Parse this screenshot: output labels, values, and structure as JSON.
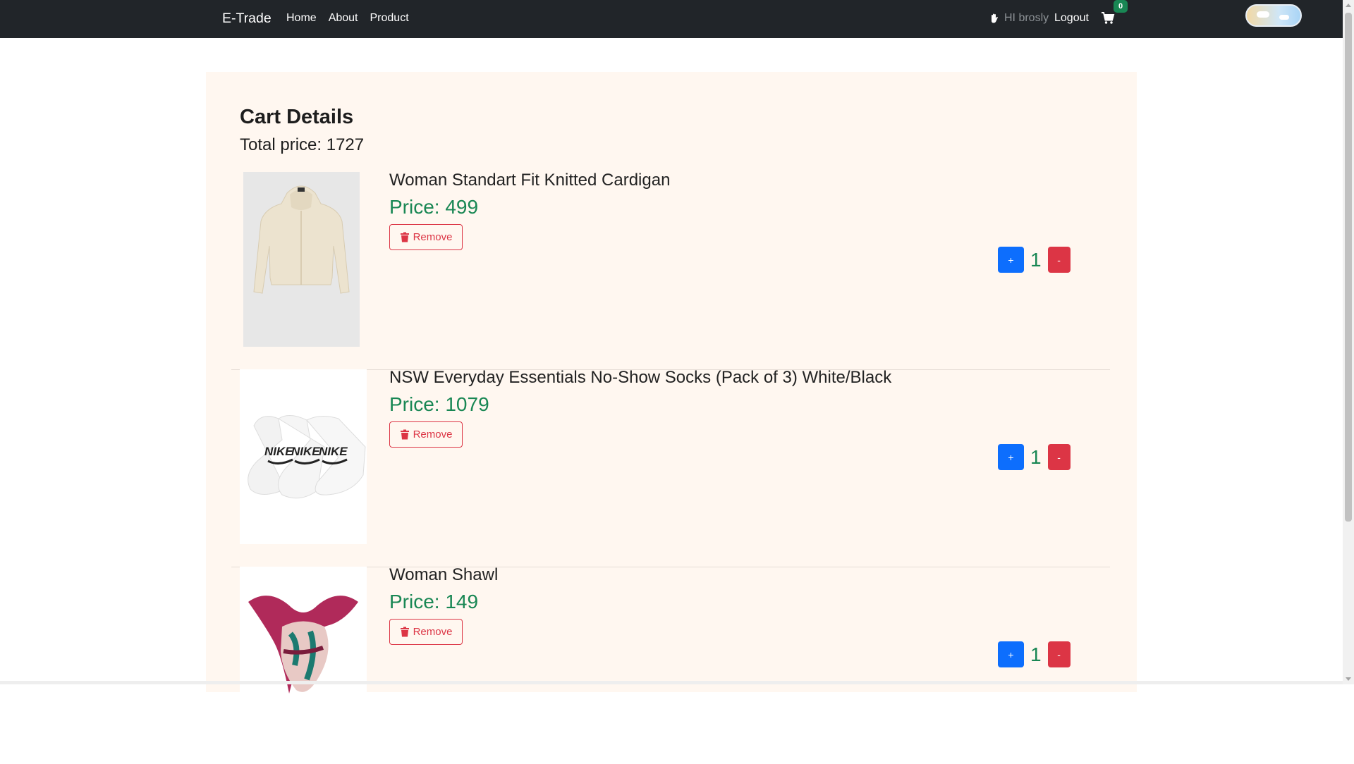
{
  "navbar": {
    "brand": "E-Trade",
    "links": [
      "Home",
      "About",
      "Product"
    ],
    "greeting": "HI brosly",
    "logout": "Logout",
    "cart_count": "0"
  },
  "cart": {
    "title": "Cart Details",
    "total_label": "Total price:",
    "total_value": "1727",
    "remove_label": "Remove",
    "plus_label": "+",
    "minus_label": "-",
    "items": [
      {
        "name": "Woman Standart Fit Knitted Cardigan",
        "price_label": "Price:",
        "price": "499",
        "qty": "1"
      },
      {
        "name": "NSW Everyday Essentials No-Show Socks (Pack of 3) White/Black",
        "price_label": "Price:",
        "price": "1079",
        "qty": "1"
      },
      {
        "name": "Woman Shawl",
        "price_label": "Price:",
        "price": "149",
        "qty": "1"
      }
    ]
  },
  "colors": {
    "navbar_bg": "#212529",
    "container_bg": "#fff7f0",
    "price_green": "#198754",
    "primary_blue": "#0d6efd",
    "danger_red": "#dc3545"
  }
}
